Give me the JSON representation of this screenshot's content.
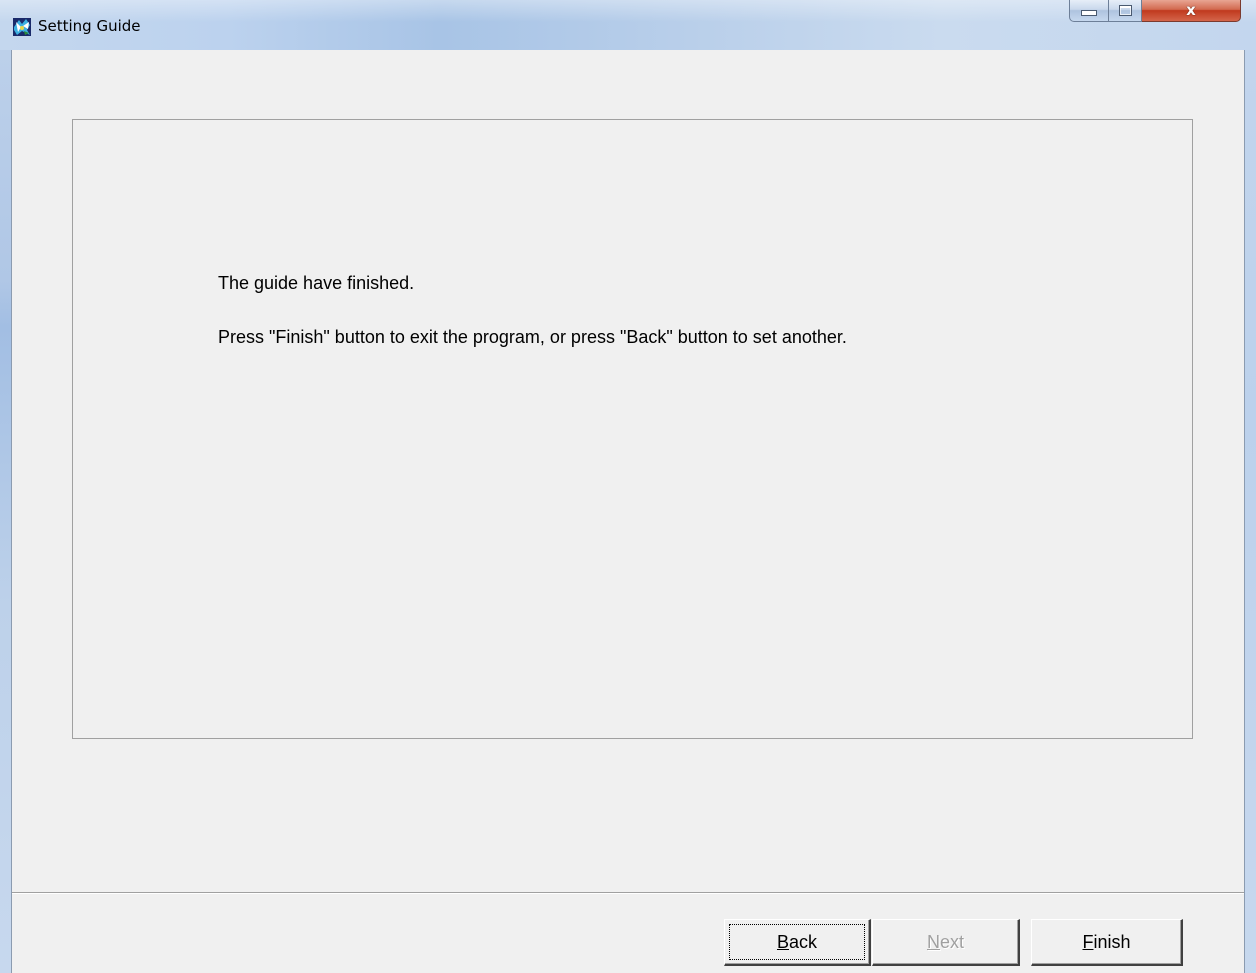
{
  "window": {
    "title": "Setting Guide",
    "app_icon": "setting-guide-app-icon",
    "caption": {
      "minimize_icon": "minimize-icon",
      "maximize_icon": "maximize-icon",
      "close_icon": "close-icon",
      "close_glyph": "x"
    }
  },
  "message": {
    "line1": "The guide have finished.",
    "line2": "Press \"Finish\" button to exit the program, or press \"Back\" button to set another."
  },
  "buttons": {
    "back": {
      "accel": "B",
      "rest": "ack",
      "enabled": true,
      "focused": true
    },
    "next": {
      "accel": "N",
      "rest": "ext",
      "enabled": false
    },
    "finish": {
      "accel": "F",
      "rest": "inish",
      "enabled": true
    }
  },
  "colors": {
    "dialog_bg": "#f0f0f0",
    "disabled_text": "#a0a0a0",
    "close_button": "#c0391e"
  }
}
